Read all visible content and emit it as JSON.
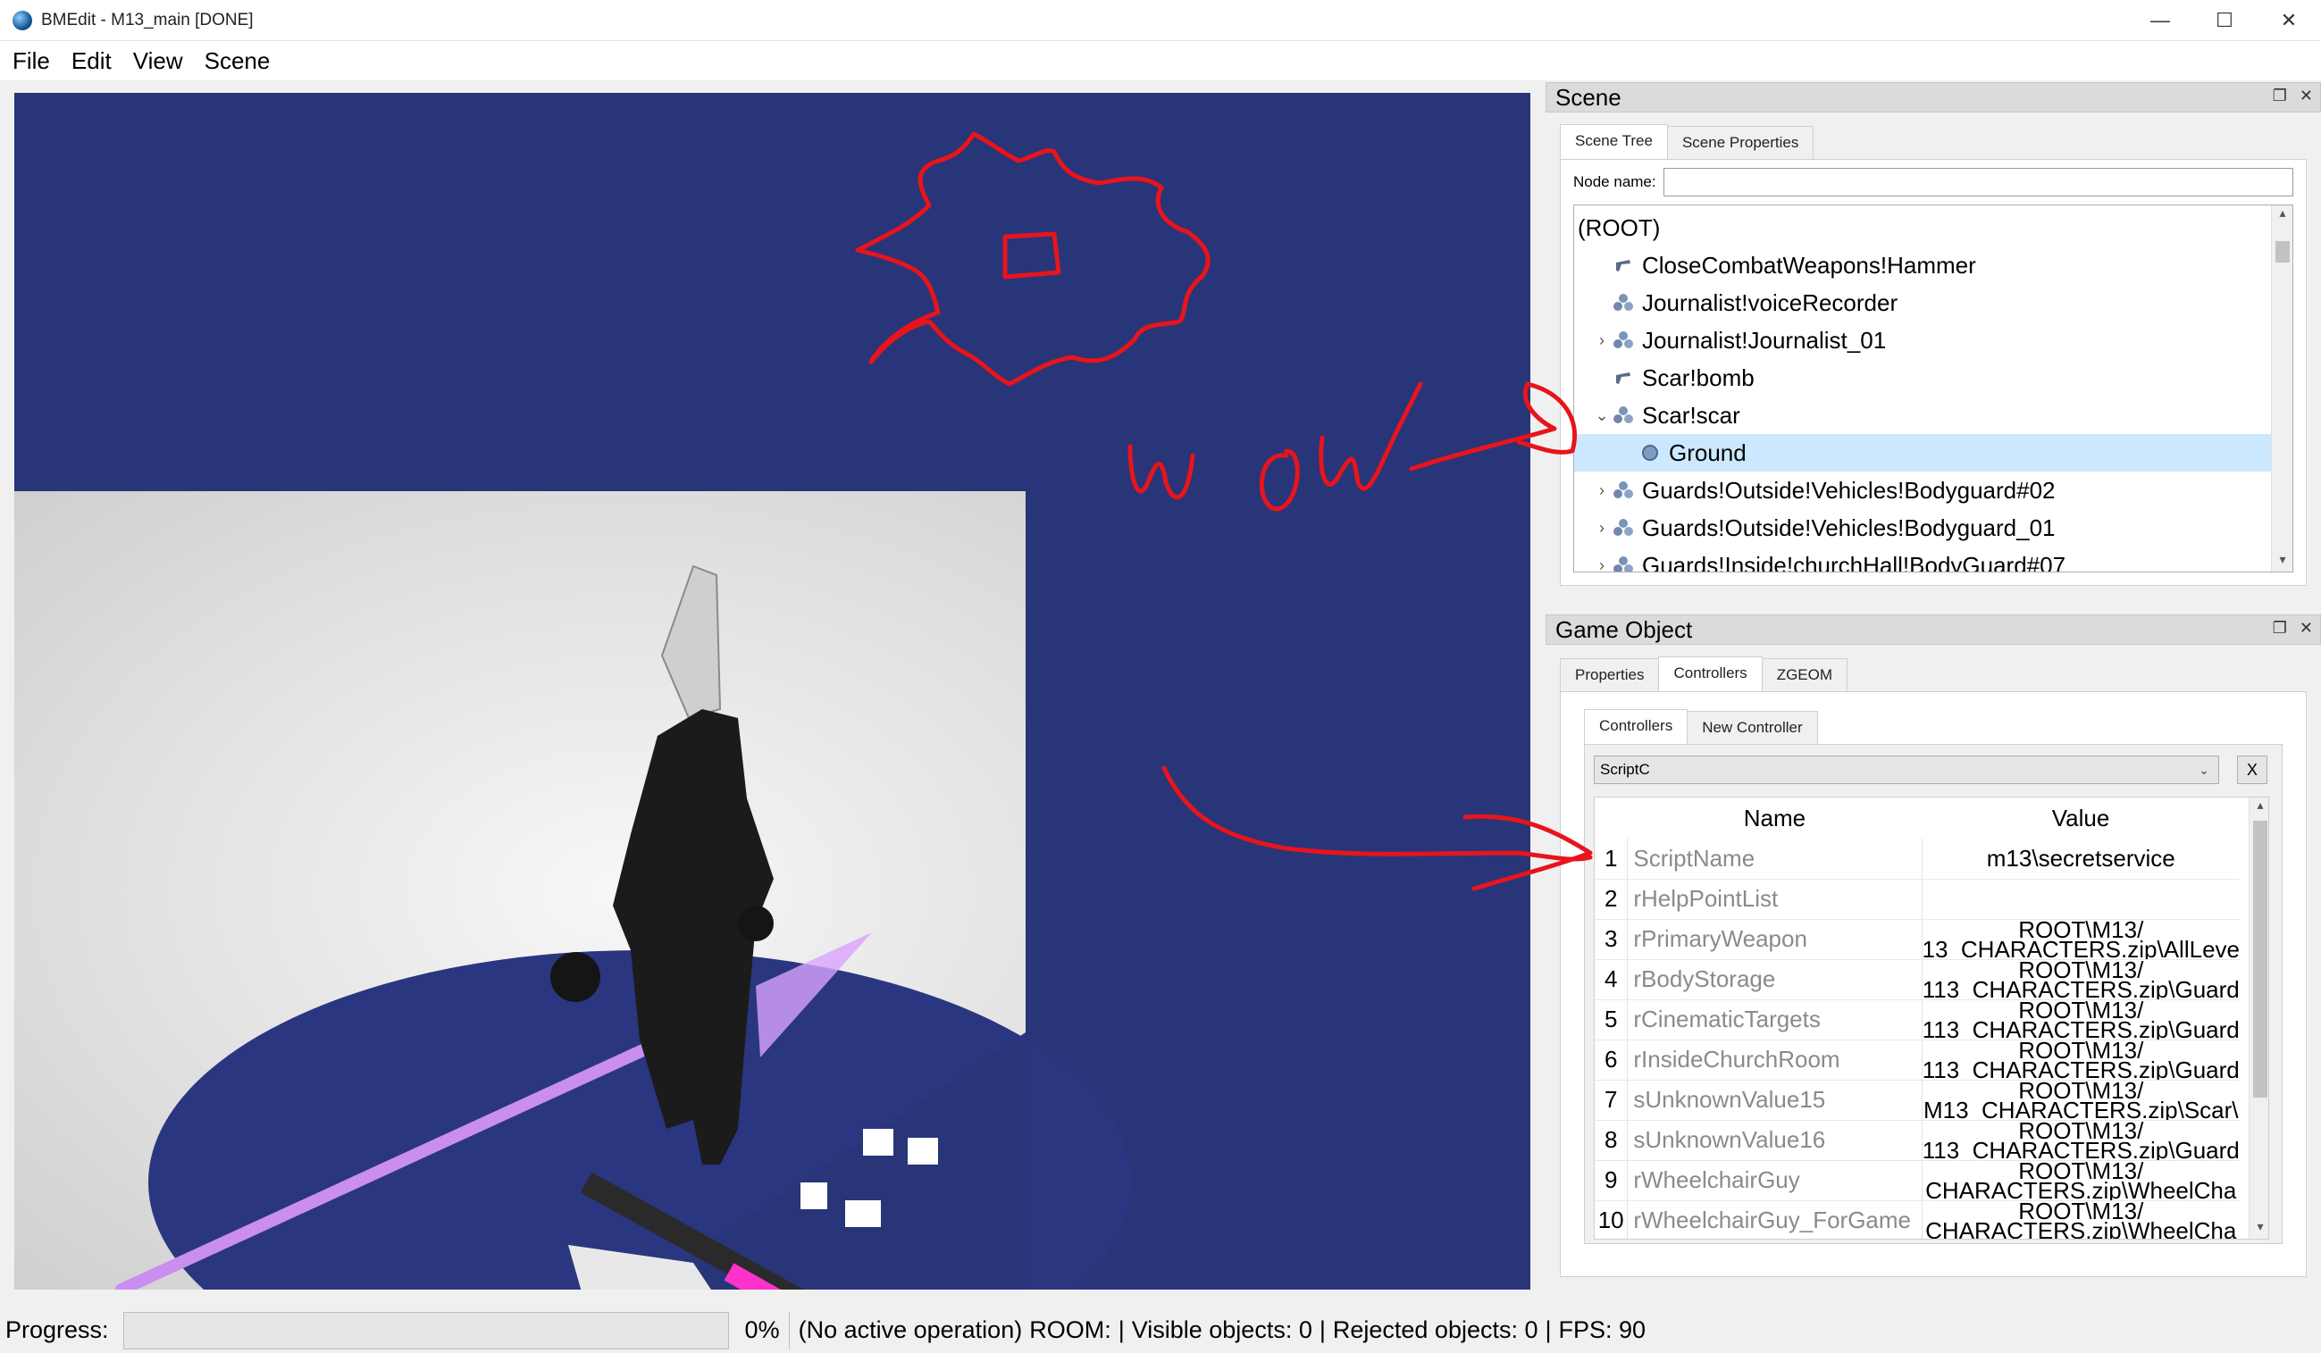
{
  "window": {
    "title": "BMEdit - M13_main [DONE]",
    "minimize": "—",
    "maximize": "☐",
    "close": "✕"
  },
  "menu": [
    "File",
    "Edit",
    "View",
    "Scene"
  ],
  "scene_panel": {
    "title": "Scene",
    "tabs": [
      "Scene Tree",
      "Scene Properties"
    ],
    "node_name_label": "Node name:",
    "node_name_value": "",
    "tree": [
      {
        "label": "(ROOT)",
        "level": 0,
        "icon": "none",
        "expander": ""
      },
      {
        "label": "CloseCombatWeapons!Hammer",
        "level": 1,
        "icon": "weapon-icon",
        "expander": ""
      },
      {
        "label": "Journalist!voiceRecorder",
        "level": 1,
        "icon": "group-icon",
        "expander": ""
      },
      {
        "label": "Journalist!Journalist_01",
        "level": 1,
        "icon": "group-icon",
        "expander": "›"
      },
      {
        "label": "Scar!bomb",
        "level": 1,
        "icon": "weapon-icon",
        "expander": ""
      },
      {
        "label": "Scar!scar",
        "level": 1,
        "icon": "group-icon",
        "expander": "⌄"
      },
      {
        "label": "Ground",
        "level": 2,
        "icon": "geom-icon",
        "expander": "",
        "selected": true
      },
      {
        "label": "Guards!Outside!Vehicles!Bodyguard#02",
        "level": 1,
        "icon": "group-icon",
        "expander": "›"
      },
      {
        "label": "Guards!Outside!Vehicles!Bodyguard_01",
        "level": 1,
        "icon": "group-icon",
        "expander": "›"
      },
      {
        "label": "Guards!Inside!churchHall!BodyGuard#07",
        "level": 1,
        "icon": "group-icon",
        "expander": "›"
      }
    ]
  },
  "game_object_panel": {
    "title": "Game Object",
    "tabs": [
      "Properties",
      "Controllers",
      "ZGEOM"
    ],
    "subtabs": [
      "Controllers",
      "New Controller"
    ],
    "controller_select": "ScriptC",
    "remove_label": "X",
    "columns": [
      "Name",
      "Value"
    ],
    "rows": [
      {
        "n": "1",
        "name": "ScriptName",
        "value": "m13\\secretservice"
      },
      {
        "n": "2",
        "name": "rHelpPointList",
        "value": ""
      },
      {
        "n": "3",
        "name": "rPrimaryWeapon",
        "value": "ROOT\\M13/\n13_CHARACTERS.zip\\AllLeve"
      },
      {
        "n": "4",
        "name": "rBodyStorage",
        "value": "ROOT\\M13/\n113_CHARACTERS.zip\\Guard"
      },
      {
        "n": "5",
        "name": "rCinematicTargets",
        "value": "ROOT\\M13/\n113_CHARACTERS.zip\\Guard"
      },
      {
        "n": "6",
        "name": "rInsideChurchRoom",
        "value": "ROOT\\M13/\n113_CHARACTERS.zip\\Guard"
      },
      {
        "n": "7",
        "name": "sUnknownValue15",
        "value": "ROOT\\M13/\nM13_CHARACTERS.zip\\Scar\\"
      },
      {
        "n": "8",
        "name": "sUnknownValue16",
        "value": "ROOT\\M13/\n113_CHARACTERS.zip\\Guard"
      },
      {
        "n": "9",
        "name": "rWheelchairGuy",
        "value": "ROOT\\M13/\nCHARACTERS.zip\\WheelCha"
      },
      {
        "n": "10",
        "name": "rWheelchairGuy_ForGame",
        "value": "ROOT\\M13/\nCHARACTERS.zip\\WheelCha"
      }
    ]
  },
  "annotation": {
    "text": "wow",
    "color": "#e8141c"
  },
  "status": {
    "progress_label": "Progress:",
    "progress_percent": "0%",
    "progress_value": 0,
    "operation": "(No active operation)",
    "room": "ROOM:",
    "visible": "Visible objects: 0",
    "rejected": "Rejected objects: 0",
    "fps": "FPS: 90"
  },
  "colors": {
    "viewport_bg": "#283578",
    "selection": "#cce8ff"
  }
}
